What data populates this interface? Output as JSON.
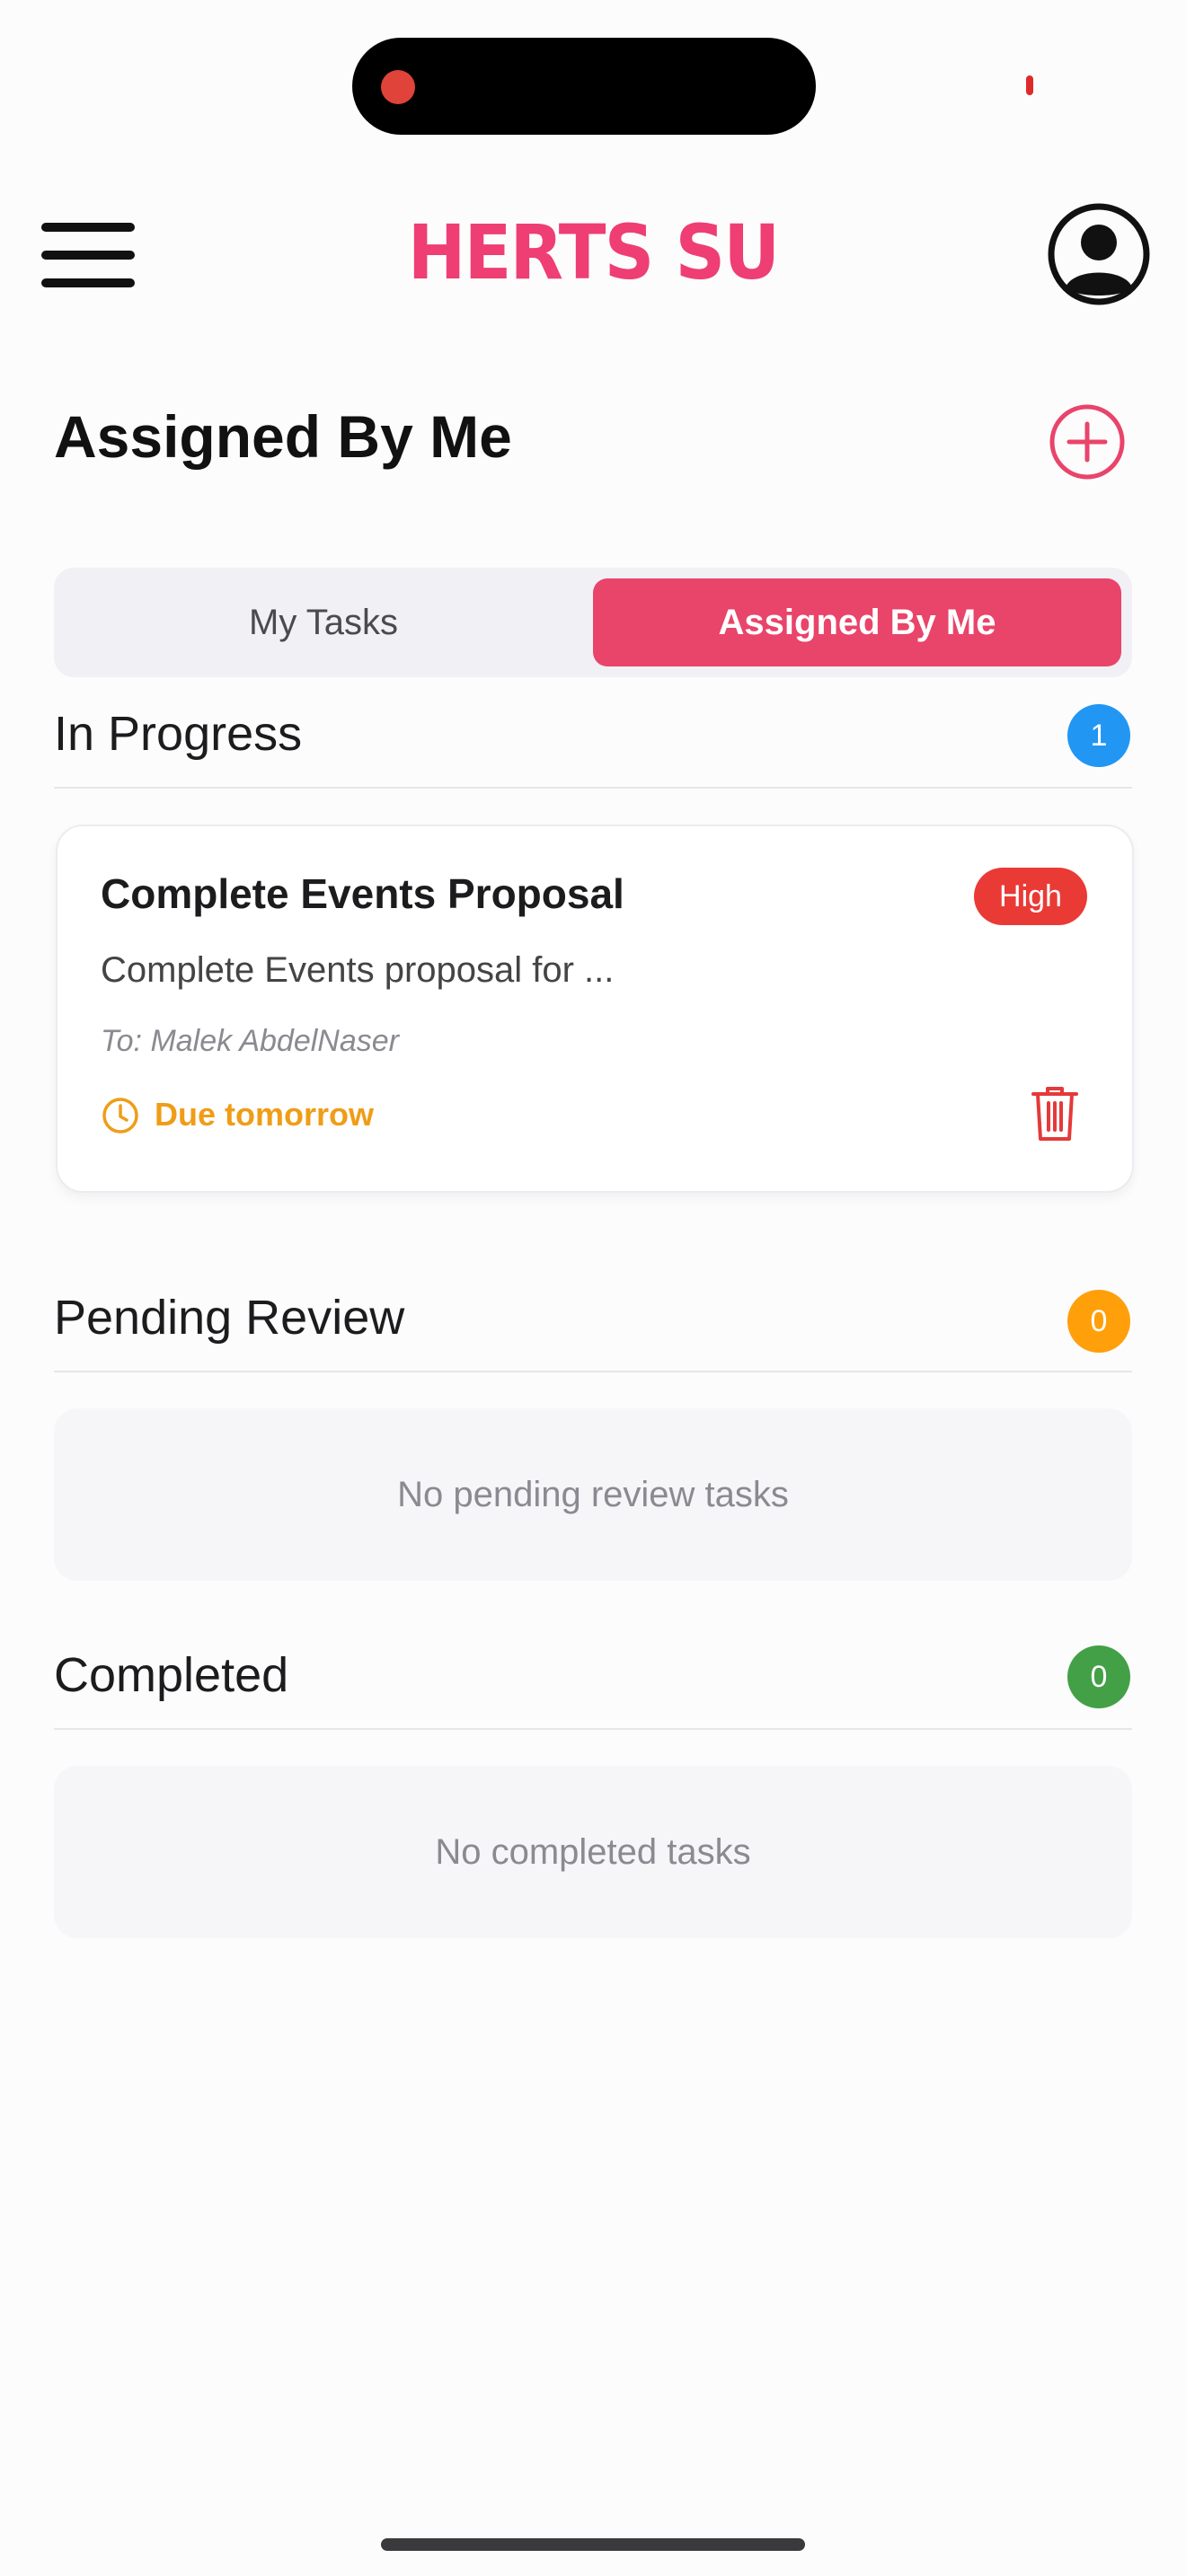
{
  "header": {
    "logo_text": "HERTS SU",
    "menu_icon": "hamburger-menu-icon",
    "profile_icon": "user-circle-icon"
  },
  "page": {
    "title": "Assigned By Me",
    "add_icon": "plus-circle-icon"
  },
  "tabs": [
    {
      "label": "My Tasks",
      "selected": false
    },
    {
      "label": "Assigned By Me",
      "selected": true
    }
  ],
  "sections": {
    "in_progress": {
      "title": "In Progress",
      "count": "1",
      "tasks": [
        {
          "title": "Complete Events Proposal",
          "priority": "High",
          "description": "Complete Events proposal for ...",
          "assignee": "To: Malek AbdelNaser",
          "due": "Due tomorrow"
        }
      ]
    },
    "pending_review": {
      "title": "Pending Review",
      "count": "0",
      "empty_text": "No pending review tasks"
    },
    "completed": {
      "title": "Completed",
      "count": "0",
      "empty_text": "No completed tasks"
    }
  },
  "colors": {
    "accent": "#e9446a",
    "logo": "#ee3e73",
    "in_progress_badge": "#2196f3",
    "pending_badge": "#ff9f0a",
    "completed_badge": "#43a047",
    "priority_high": "#ea3a36",
    "due": "#ef9d17",
    "delete": "#e5393a"
  }
}
